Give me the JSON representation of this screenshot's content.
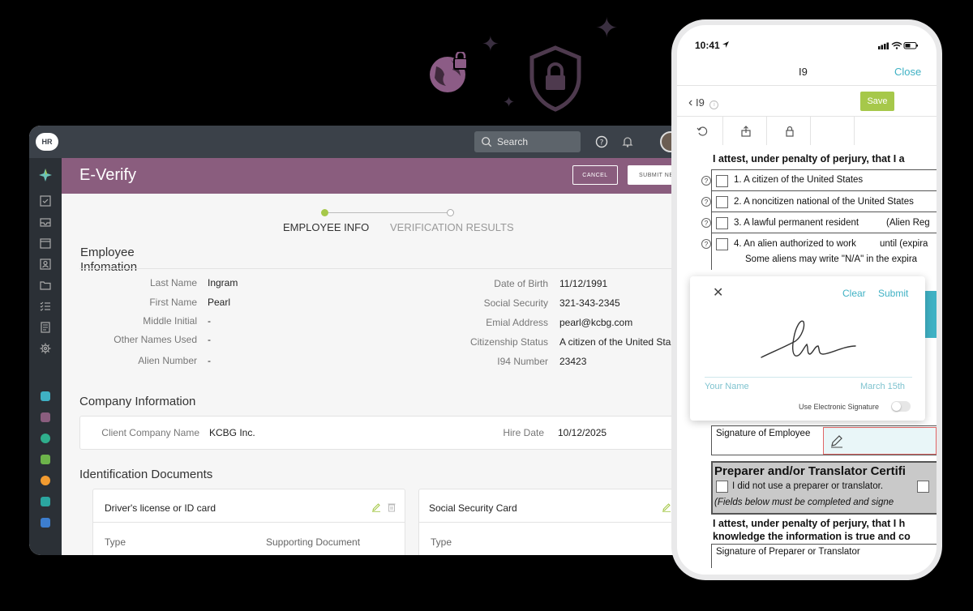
{
  "desktop": {
    "logo": "HR",
    "search": {
      "placeholder": "Search"
    },
    "page_title": "E-Verify",
    "buttons": {
      "cancel": "CANCEL",
      "submit": "SUBMIT NE"
    },
    "steps": [
      {
        "label": "EMPLOYEE INFO",
        "active": true
      },
      {
        "label": "VERIFICATION RESULTS",
        "active": false
      }
    ],
    "employee": {
      "title_line1": "Employee",
      "title_line2": "Infomation",
      "left": [
        {
          "label": "Last Name",
          "value": "Ingram"
        },
        {
          "label": "First Name",
          "value": "Pearl"
        },
        {
          "label": "Middle Initial",
          "value": "-"
        },
        {
          "label": "Other Names Used",
          "value": "-"
        },
        {
          "label": "Alien Number",
          "value": "-"
        }
      ],
      "right": [
        {
          "label": "Date of Birth",
          "value": "11/12/1991"
        },
        {
          "label": "Social Security",
          "value": "321-343-2345"
        },
        {
          "label": "Emial Address",
          "value": "pearl@kcbg.com"
        },
        {
          "label": "Citizenship Status",
          "value": "A citizen of the United Sta"
        },
        {
          "label": "I94 Number",
          "value": "23423"
        }
      ]
    },
    "company": {
      "title": "Company Information",
      "client_label": "Client Company Name",
      "client_value": "KCBG Inc.",
      "hire_label": "Hire Date",
      "hire_value": "10/12/2025"
    },
    "documents": {
      "title": "Identification Documents",
      "cards": [
        {
          "title": "Driver's license or ID card",
          "col1": "Type",
          "col2": "Supporting Document"
        },
        {
          "title": "Social Security Card",
          "col1": "Type"
        }
      ]
    },
    "colors": {
      "accent": "#8a5d7e",
      "topbar": "#3b4149",
      "sidebar": "#2b3036",
      "step_active": "#a6c84a"
    }
  },
  "phone": {
    "time": "10:41",
    "nav_title": "I9",
    "close": "Close",
    "back": "I9",
    "save": "Save",
    "form": {
      "attest": "I attest, under penalty of perjury, that I a",
      "options": [
        "1. A citizen of the United States",
        "2. A noncitizen national of the United States",
        "3. A lawful permanent resident",
        "4. An alien authorized to work"
      ],
      "option3_extra": "(Alien Reg",
      "option4_extra": "until (expira",
      "option4_note": "Some aliens may write \"N/A\" in the expira",
      "signature_employee": "Signature of Employee",
      "preparer_title": "Preparer and/or Translator Certifi",
      "preparer_option": "I did not use a preparer or translator.",
      "preparer_note": "(Fields below must be completed and signe",
      "attest2_line1": "I attest, under penalty of perjury, that I h",
      "attest2_line2": "knowledge the information is true and co",
      "signature_preparer": "Signature of Preparer or Translator"
    },
    "signature_modal": {
      "clear": "Clear",
      "submit": "Submit",
      "your_name": "Your Name",
      "date": "March 15th",
      "toggle_label": "Use Electronic Signature",
      "toggle_on": false
    },
    "colors": {
      "link": "#3fb1c4",
      "save": "#a6c84a"
    }
  }
}
